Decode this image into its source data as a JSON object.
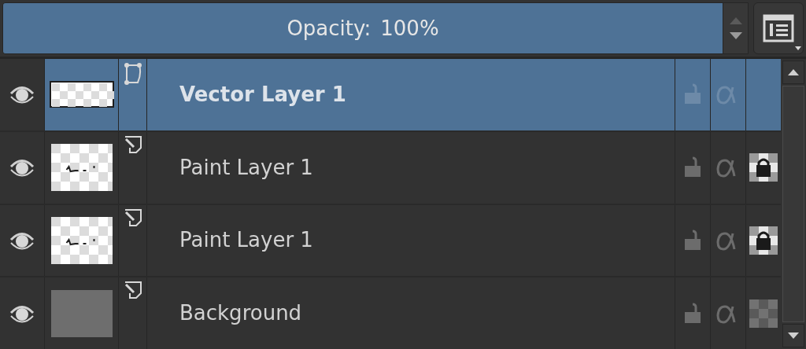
{
  "opacity": {
    "label": "Opacity:",
    "value": "100%",
    "level": 1
  },
  "layers": [
    {
      "name": "Vector Layer 1",
      "kind": "vector",
      "selected": true,
      "visible": true,
      "locked": false
    },
    {
      "name": "Paint Layer 1",
      "kind": "paint",
      "selected": false,
      "visible": true,
      "locked": false,
      "alpha_locked": true
    },
    {
      "name": "Paint Layer 1",
      "kind": "paint",
      "selected": false,
      "visible": true,
      "locked": false,
      "alpha_locked": true
    },
    {
      "name": "Background",
      "kind": "background",
      "selected": false,
      "visible": true,
      "locked": false,
      "alpha_locked": false
    }
  ]
}
